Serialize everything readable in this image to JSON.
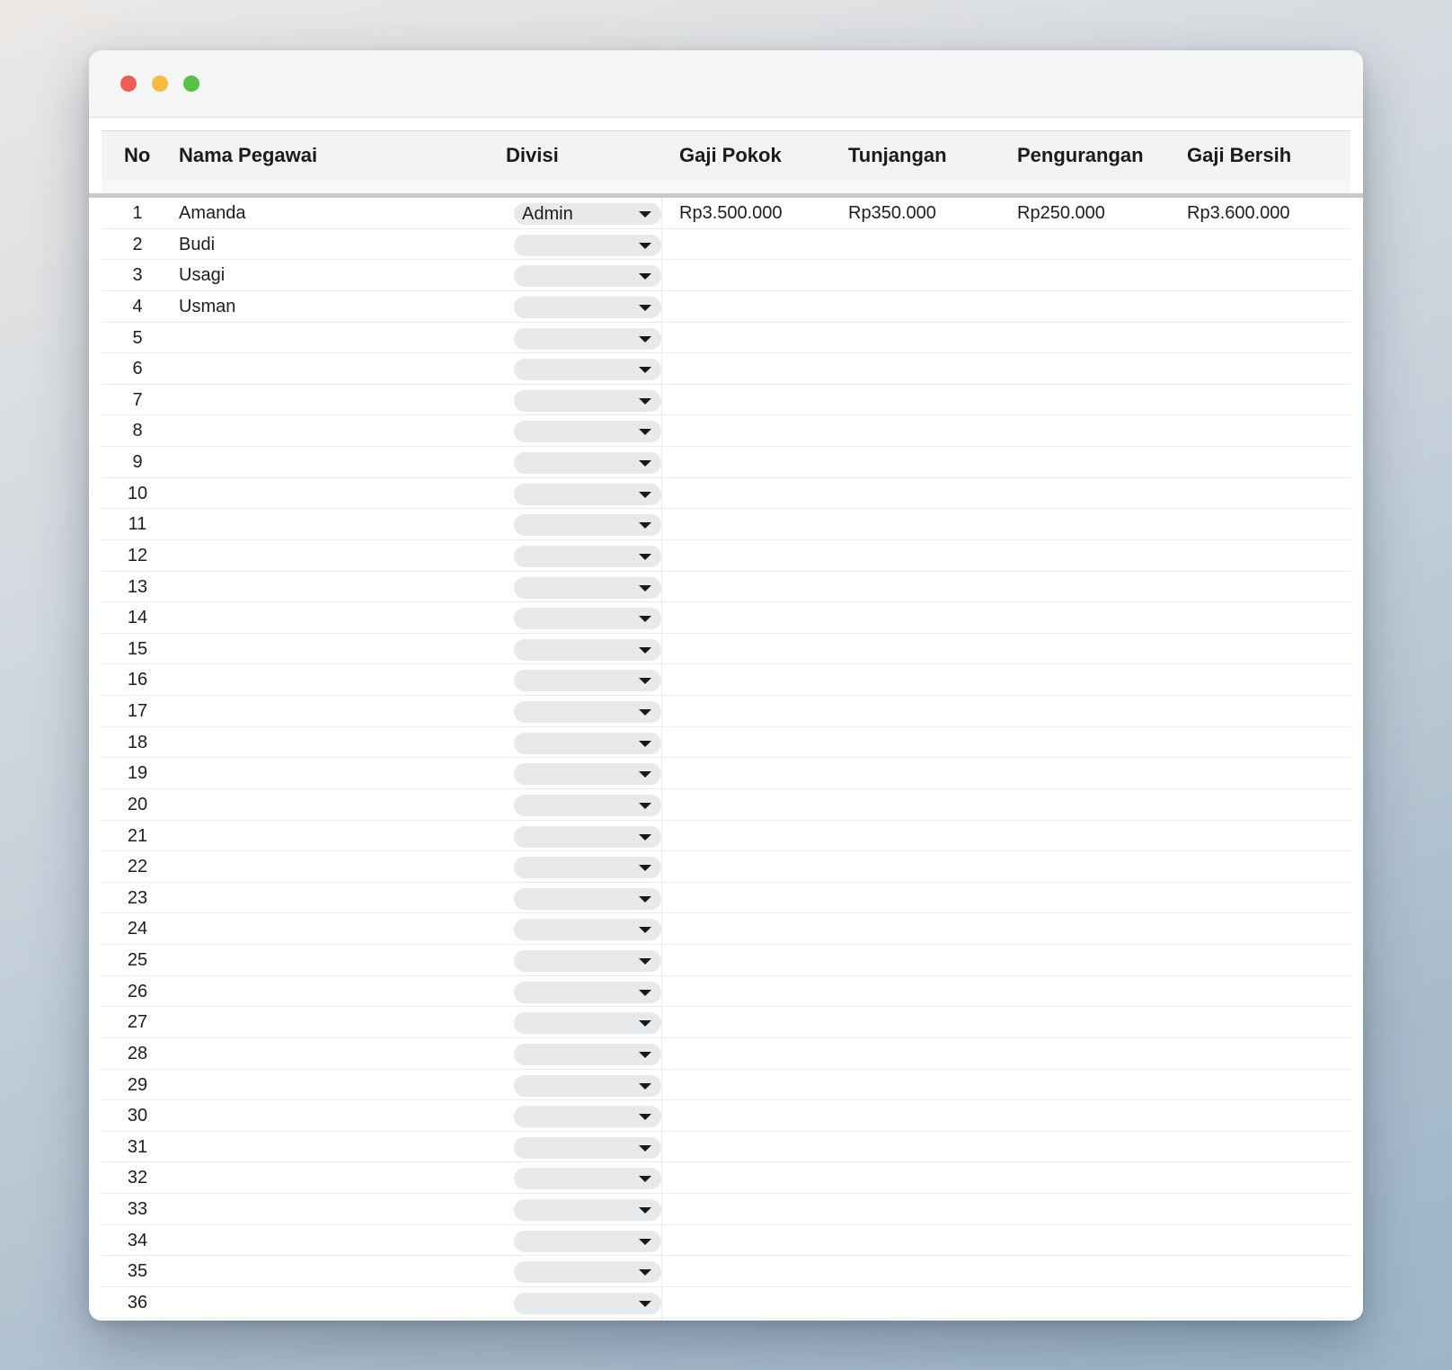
{
  "window": {
    "traffic_lights": [
      "close",
      "minimize",
      "maximize"
    ]
  },
  "table": {
    "columns": [
      "No",
      "Nama Pegawai",
      "Divisi",
      "Gaji Pokok",
      "Tunjangan",
      "Pengurangan",
      "Gaji Bersih"
    ],
    "rows": [
      {
        "no": "1",
        "nama": "Amanda",
        "divisi": "Admin",
        "gaji_pokok": "Rp3.500.000",
        "tunjangan": "Rp350.000",
        "pengurangan": "Rp250.000",
        "gaji_bersih": "Rp3.600.000"
      },
      {
        "no": "2",
        "nama": "Budi",
        "divisi": "",
        "gaji_pokok": "",
        "tunjangan": "",
        "pengurangan": "",
        "gaji_bersih": ""
      },
      {
        "no": "3",
        "nama": "Usagi",
        "divisi": "",
        "gaji_pokok": "",
        "tunjangan": "",
        "pengurangan": "",
        "gaji_bersih": ""
      },
      {
        "no": "4",
        "nama": "Usman",
        "divisi": "",
        "gaji_pokok": "",
        "tunjangan": "",
        "pengurangan": "",
        "gaji_bersih": ""
      },
      {
        "no": "5",
        "nama": "",
        "divisi": "",
        "gaji_pokok": "",
        "tunjangan": "",
        "pengurangan": "",
        "gaji_bersih": ""
      },
      {
        "no": "6",
        "nama": "",
        "divisi": "",
        "gaji_pokok": "",
        "tunjangan": "",
        "pengurangan": "",
        "gaji_bersih": ""
      },
      {
        "no": "7",
        "nama": "",
        "divisi": "",
        "gaji_pokok": "",
        "tunjangan": "",
        "pengurangan": "",
        "gaji_bersih": ""
      },
      {
        "no": "8",
        "nama": "",
        "divisi": "",
        "gaji_pokok": "",
        "tunjangan": "",
        "pengurangan": "",
        "gaji_bersih": ""
      },
      {
        "no": "9",
        "nama": "",
        "divisi": "",
        "gaji_pokok": "",
        "tunjangan": "",
        "pengurangan": "",
        "gaji_bersih": ""
      },
      {
        "no": "10",
        "nama": "",
        "divisi": "",
        "gaji_pokok": "",
        "tunjangan": "",
        "pengurangan": "",
        "gaji_bersih": ""
      },
      {
        "no": "11",
        "nama": "",
        "divisi": "",
        "gaji_pokok": "",
        "tunjangan": "",
        "pengurangan": "",
        "gaji_bersih": ""
      },
      {
        "no": "12",
        "nama": "",
        "divisi": "",
        "gaji_pokok": "",
        "tunjangan": "",
        "pengurangan": "",
        "gaji_bersih": ""
      },
      {
        "no": "13",
        "nama": "",
        "divisi": "",
        "gaji_pokok": "",
        "tunjangan": "",
        "pengurangan": "",
        "gaji_bersih": ""
      },
      {
        "no": "14",
        "nama": "",
        "divisi": "",
        "gaji_pokok": "",
        "tunjangan": "",
        "pengurangan": "",
        "gaji_bersih": ""
      },
      {
        "no": "15",
        "nama": "",
        "divisi": "",
        "gaji_pokok": "",
        "tunjangan": "",
        "pengurangan": "",
        "gaji_bersih": ""
      },
      {
        "no": "16",
        "nama": "",
        "divisi": "",
        "gaji_pokok": "",
        "tunjangan": "",
        "pengurangan": "",
        "gaji_bersih": ""
      },
      {
        "no": "17",
        "nama": "",
        "divisi": "",
        "gaji_pokok": "",
        "tunjangan": "",
        "pengurangan": "",
        "gaji_bersih": ""
      },
      {
        "no": "18",
        "nama": "",
        "divisi": "",
        "gaji_pokok": "",
        "tunjangan": "",
        "pengurangan": "",
        "gaji_bersih": ""
      },
      {
        "no": "19",
        "nama": "",
        "divisi": "",
        "gaji_pokok": "",
        "tunjangan": "",
        "pengurangan": "",
        "gaji_bersih": ""
      },
      {
        "no": "20",
        "nama": "",
        "divisi": "",
        "gaji_pokok": "",
        "tunjangan": "",
        "pengurangan": "",
        "gaji_bersih": ""
      },
      {
        "no": "21",
        "nama": "",
        "divisi": "",
        "gaji_pokok": "",
        "tunjangan": "",
        "pengurangan": "",
        "gaji_bersih": ""
      },
      {
        "no": "22",
        "nama": "",
        "divisi": "",
        "gaji_pokok": "",
        "tunjangan": "",
        "pengurangan": "",
        "gaji_bersih": ""
      },
      {
        "no": "23",
        "nama": "",
        "divisi": "",
        "gaji_pokok": "",
        "tunjangan": "",
        "pengurangan": "",
        "gaji_bersih": ""
      },
      {
        "no": "24",
        "nama": "",
        "divisi": "",
        "gaji_pokok": "",
        "tunjangan": "",
        "pengurangan": "",
        "gaji_bersih": ""
      },
      {
        "no": "25",
        "nama": "",
        "divisi": "",
        "gaji_pokok": "",
        "tunjangan": "",
        "pengurangan": "",
        "gaji_bersih": ""
      },
      {
        "no": "26",
        "nama": "",
        "divisi": "",
        "gaji_pokok": "",
        "tunjangan": "",
        "pengurangan": "",
        "gaji_bersih": ""
      },
      {
        "no": "27",
        "nama": "",
        "divisi": "",
        "gaji_pokok": "",
        "tunjangan": "",
        "pengurangan": "",
        "gaji_bersih": ""
      },
      {
        "no": "28",
        "nama": "",
        "divisi": "",
        "gaji_pokok": "",
        "tunjangan": "",
        "pengurangan": "",
        "gaji_bersih": ""
      },
      {
        "no": "29",
        "nama": "",
        "divisi": "",
        "gaji_pokok": "",
        "tunjangan": "",
        "pengurangan": "",
        "gaji_bersih": ""
      },
      {
        "no": "30",
        "nama": "",
        "divisi": "",
        "gaji_pokok": "",
        "tunjangan": "",
        "pengurangan": "",
        "gaji_bersih": ""
      },
      {
        "no": "31",
        "nama": "",
        "divisi": "",
        "gaji_pokok": "",
        "tunjangan": "",
        "pengurangan": "",
        "gaji_bersih": ""
      },
      {
        "no": "32",
        "nama": "",
        "divisi": "",
        "gaji_pokok": "",
        "tunjangan": "",
        "pengurangan": "",
        "gaji_bersih": ""
      },
      {
        "no": "33",
        "nama": "",
        "divisi": "",
        "gaji_pokok": "",
        "tunjangan": "",
        "pengurangan": "",
        "gaji_bersih": ""
      },
      {
        "no": "34",
        "nama": "",
        "divisi": "",
        "gaji_pokok": "",
        "tunjangan": "",
        "pengurangan": "",
        "gaji_bersih": ""
      },
      {
        "no": "35",
        "nama": "",
        "divisi": "",
        "gaji_pokok": "",
        "tunjangan": "",
        "pengurangan": "",
        "gaji_bersih": ""
      },
      {
        "no": "36",
        "nama": "",
        "divisi": "",
        "gaji_pokok": "",
        "tunjangan": "",
        "pengurangan": "",
        "gaji_bersih": ""
      }
    ]
  }
}
